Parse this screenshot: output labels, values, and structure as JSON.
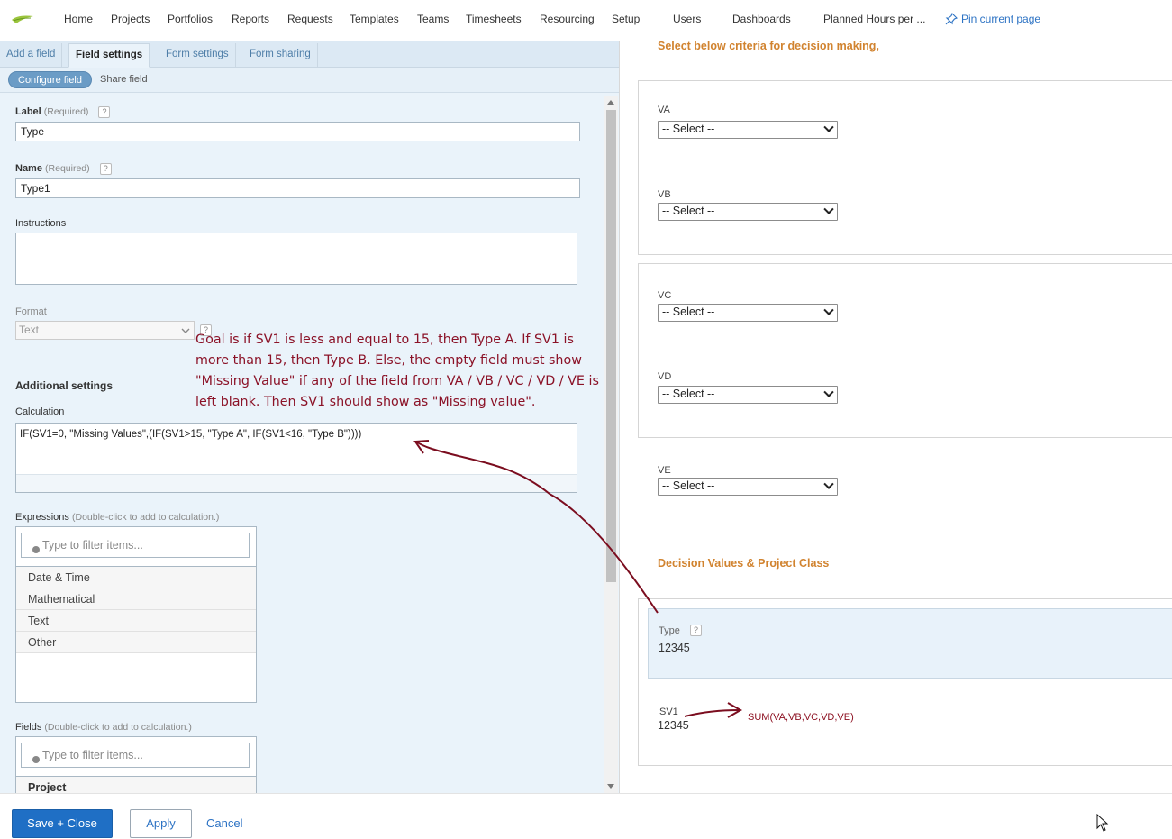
{
  "nav": {
    "items": [
      "Home",
      "Projects",
      "Portfolios",
      "Reports",
      "Requests",
      "Templates",
      "Teams",
      "Timesheets",
      "Resourcing",
      "Setup",
      "Users",
      "Dashboards",
      "Planned Hours per ..."
    ],
    "pin_label": "Pin current page"
  },
  "left": {
    "tabs": [
      "Add a field",
      "Field settings",
      "Form settings",
      "Form sharing"
    ],
    "active_tab": "Field settings",
    "subtab_active": "Configure field",
    "subtab_other": "Share field",
    "label_field": {
      "title": "Label",
      "required": "(Required)",
      "value": "Type"
    },
    "name_field": {
      "title": "Name",
      "required": "(Required)",
      "value": "Type1"
    },
    "instructions_label": "Instructions",
    "format_label": "Format",
    "format_value": "Text",
    "additional_settings": "Additional settings",
    "calculation_label": "Calculation",
    "calculation_value": "IF(SV1=0, \"Missing Values\",(IF(SV1>15, \"Type A\", IF(SV1<16, \"Type B\"))))",
    "expressions_label": "Expressions",
    "expressions_hint": "(Double-click to add to calculation.)",
    "filter_placeholder": "Type to filter items...",
    "expression_items": [
      "Date & Time",
      "Mathematical",
      "Text",
      "Other"
    ],
    "fields_label": "Fields",
    "fields_hint": "(Double-click to add to calculation.)",
    "field_items": [
      "Project"
    ]
  },
  "annotation": {
    "note": "Goal is if SV1 is less and equal to 15, then Type A. If SV1 is more than 15, then Type B. Else, the empty field must show \"Missing Value\" if any of the field from VA / VB / VC / VD / VE is left blank. Then SV1 should show as \"Missing value\".",
    "sum_note": "SUM(VA,VB,VC,VD,VE)",
    "color": "#8b1227"
  },
  "right": {
    "criteria_title": "Select below criteria for decision making,",
    "select_placeholder": "-- Select --",
    "fields": [
      "VA",
      "VB",
      "VC",
      "VD",
      "VE"
    ],
    "section_title": "Decision Values & Project Class",
    "type_label": "Type",
    "type_value": "12345",
    "sv1_label": "SV1",
    "sv1_value": "12345"
  },
  "buttons": {
    "save_close": "Save + Close",
    "apply": "Apply",
    "cancel": "Cancel"
  },
  "colors": {
    "accent": "#1f6fc5",
    "heading_orange": "#d1832f",
    "panel_bg": "#eaf3fa"
  }
}
